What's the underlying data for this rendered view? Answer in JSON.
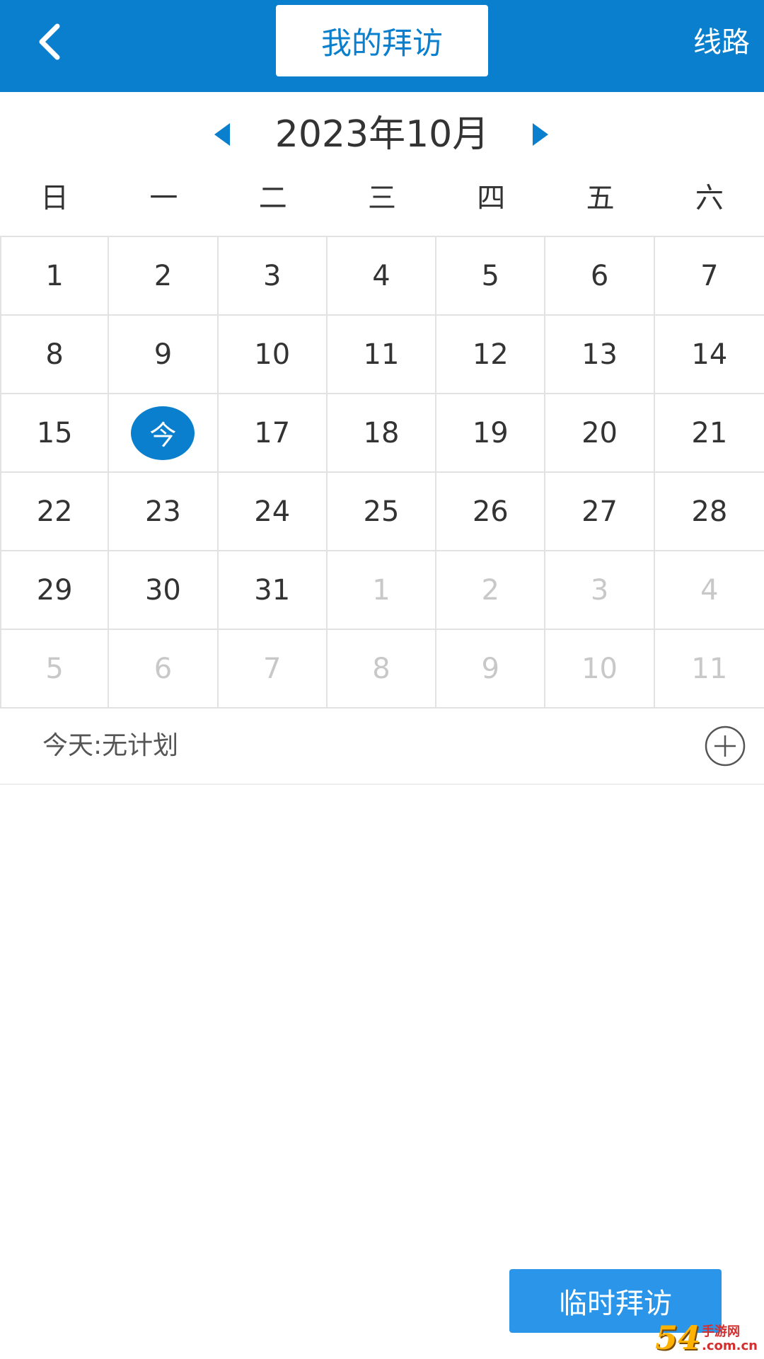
{
  "header": {
    "title": "我的拜访",
    "route_label": "线路",
    "back_icon": "chevron-left-icon"
  },
  "calendar": {
    "month_label": "2023年10月",
    "prev_icon": "triangle-left-icon",
    "next_icon": "triangle-right-icon",
    "weekdays": [
      "日",
      "一",
      "二",
      "三",
      "四",
      "五",
      "六"
    ],
    "today_label": "今",
    "cells": [
      "1",
      "2",
      "3",
      "4",
      "5",
      "6",
      "7",
      "8",
      "9",
      "10",
      "11",
      "12",
      "13",
      "14",
      "15",
      "今",
      "17",
      "18",
      "19",
      "20",
      "21",
      "22",
      "23",
      "24",
      "25",
      "26",
      "27",
      "28",
      "29",
      "30",
      "31",
      "1",
      "2",
      "3",
      "4",
      "5",
      "6",
      "7",
      "8",
      "9",
      "10",
      "11"
    ]
  },
  "plan": {
    "today_text": "今天:无计划",
    "add_icon": "plus-circle-icon"
  },
  "actions": {
    "temp_visit_label": "临时拜访"
  },
  "watermark": {
    "logo": "54",
    "line1": "手游网",
    "line2": ".com.cn"
  },
  "colors": {
    "primary": "#0a7fcd",
    "button": "#2b95e9",
    "text": "#333333",
    "muted": "#c8c8c8"
  }
}
